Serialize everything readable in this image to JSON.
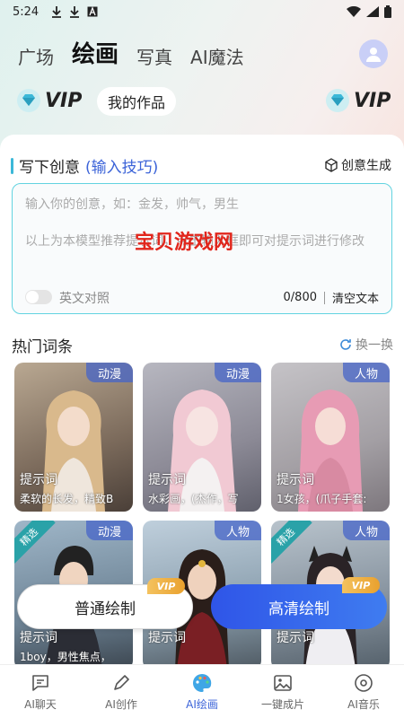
{
  "status_bar": {
    "time": "5:24",
    "left_icons": [
      "download-icon",
      "download-icon",
      "font-icon"
    ],
    "right_icons": [
      "wifi-icon",
      "signal-icon",
      "battery-icon"
    ]
  },
  "top_nav": {
    "tabs": [
      {
        "label": "广场"
      },
      {
        "label": "绘画",
        "active": true
      },
      {
        "label": "写真"
      },
      {
        "label": "AI魔法"
      }
    ]
  },
  "header": {
    "vip_left": "VIP",
    "vip_right": "VIP",
    "my_works": "我的作品"
  },
  "prompt_section": {
    "title": "写下创意",
    "tips_link": "(输入技巧)",
    "generate_button": "创意生成",
    "placeholder": "输入你的创意，如：金发，帅气，男生",
    "hint": "以上为本模型推荐提示词，点击输入框即可对提示词进行修改",
    "watermark": "宝贝游戏网",
    "english_toggle_label": "英文对照",
    "char_count": "0/800",
    "clear_button": "清空文本"
  },
  "hot_section": {
    "title": "热门词条",
    "refresh_label": "换一换",
    "items": [
      {
        "tag": "动漫",
        "prompt_title": "提示词",
        "prompt_text": "柔软的长发，精致B",
        "featured": false
      },
      {
        "tag": "动漫",
        "prompt_title": "提示词",
        "prompt_text": "水彩画，(杰作，写",
        "featured": false
      },
      {
        "tag": "人物",
        "prompt_title": "提示词",
        "prompt_text": "1女孩，(爪子手套:",
        "featured": false
      },
      {
        "tag": "动漫",
        "prompt_title": "提示词",
        "prompt_text": "1boy，男性焦点，",
        "featured": true,
        "featured_label": "精选"
      },
      {
        "tag": "人物",
        "prompt_title": "提示词",
        "prompt_text": "",
        "featured": false
      },
      {
        "tag": "人物",
        "prompt_title": "提示词",
        "prompt_text": "",
        "featured": true,
        "featured_label": "精选"
      }
    ]
  },
  "actions": {
    "normal_draw": "普通绘制",
    "hd_draw": "高清绘制",
    "vip_chip": "VIP"
  },
  "bottom_nav": [
    {
      "label": "AI聊天",
      "icon": "chat-icon"
    },
    {
      "label": "AI创作",
      "icon": "pen-icon"
    },
    {
      "label": "AI绘画",
      "icon": "palette-icon",
      "active": true
    },
    {
      "label": "一键成片",
      "icon": "image-icon"
    },
    {
      "label": "AI音乐",
      "icon": "music-disc-icon"
    }
  ],
  "colors": {
    "accent": "#3b63d8",
    "teal": "#3bb8d8",
    "watermark": "#e1261c",
    "hd_button": "#2f55e8"
  }
}
